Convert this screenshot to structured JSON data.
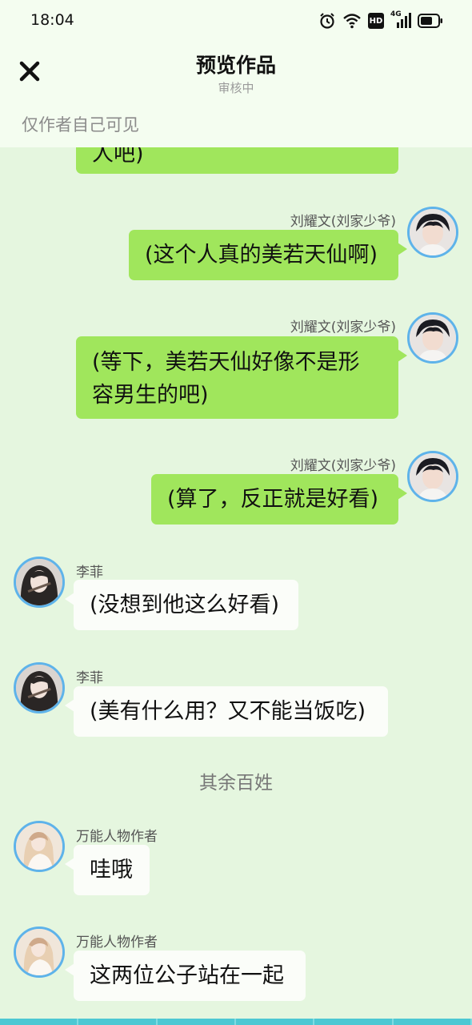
{
  "status": {
    "time": "18:04",
    "hd_label": "HD",
    "net_label": "4G"
  },
  "header": {
    "title": "预览作品",
    "subtitle": "审核中",
    "visibility_note": "仅作者自己可见"
  },
  "messages": [
    {
      "side": "right",
      "text": "人吧)",
      "partial": true
    },
    {
      "side": "right",
      "sender": "刘耀文(刘家少爷)",
      "text": "(这个人真的美若天仙啊)"
    },
    {
      "side": "right",
      "sender": "刘耀文(刘家少爷)",
      "text_line1": "(等下，美若天仙好像不是形",
      "text_line2": "容男生的吧)"
    },
    {
      "side": "right",
      "sender": "刘耀文(刘家少爷)",
      "text": "(算了，反正就是好看)"
    },
    {
      "side": "left",
      "sender": "李菲",
      "text": "(没想到他这么好看)"
    },
    {
      "side": "left",
      "sender": "李菲",
      "text": "(美有什么用？又不能当饭吃)"
    },
    {
      "side": "center",
      "text": "其余百姓"
    },
    {
      "side": "left",
      "sender": "万能人物作者",
      "text": "哇哦"
    },
    {
      "side": "left",
      "sender": "万能人物作者",
      "text": "这两位公子站在一起"
    }
  ],
  "colors": {
    "background": "#e5f6df",
    "header_bg": "#f4fdf0",
    "right_bubble": "#a0e65c",
    "left_bubble": "#fbfdf9",
    "avatar_ring": "#5eb3ea"
  }
}
